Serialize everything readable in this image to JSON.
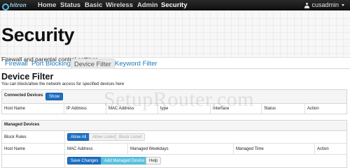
{
  "nav": {
    "brand": "hitron",
    "items": [
      {
        "label": "Home"
      },
      {
        "label": "Status"
      },
      {
        "label": "Basic"
      },
      {
        "label": "Wireless"
      },
      {
        "label": "Admin"
      },
      {
        "label": "Security",
        "active": true
      }
    ],
    "user": "cusadmin"
  },
  "hero": {
    "title": "Security",
    "subtitle": "Firewall and parental control settings"
  },
  "tabs": [
    {
      "label": "Firewall"
    },
    {
      "label": "Port Blocking"
    },
    {
      "label": "Device Filter",
      "active": true
    },
    {
      "label": "Keyword Filter"
    }
  ],
  "device_filter": {
    "title": "Device Filter",
    "description": "You can block/allow the network access for specified devices here"
  },
  "connected_devices": {
    "title": "Connected Devices",
    "show_button": "Show",
    "columns": [
      "Host Name",
      "IP Address",
      "MAC Address",
      "type",
      "Interface",
      "Status",
      "Action"
    ]
  },
  "managed_devices": {
    "title": "Managed Devices",
    "block_rules_label": "Block Rules",
    "block_rule_options": [
      "Allow All",
      "Allow Listed",
      "Block Listed"
    ],
    "selected_rule": "Allow All",
    "columns": [
      "Host Name",
      "MAC Address",
      "Managed Weekdays",
      "Managed Time",
      "Action"
    ]
  },
  "buttons": {
    "save": "Save Changes",
    "add": "Add Managed Device",
    "help": "Help"
  },
  "watermark": "SetupRouter.com",
  "colors": {
    "navbar": "#111111",
    "link": "#1a7bb9",
    "primary": "#1e6fc2",
    "info": "#5bc0de"
  }
}
